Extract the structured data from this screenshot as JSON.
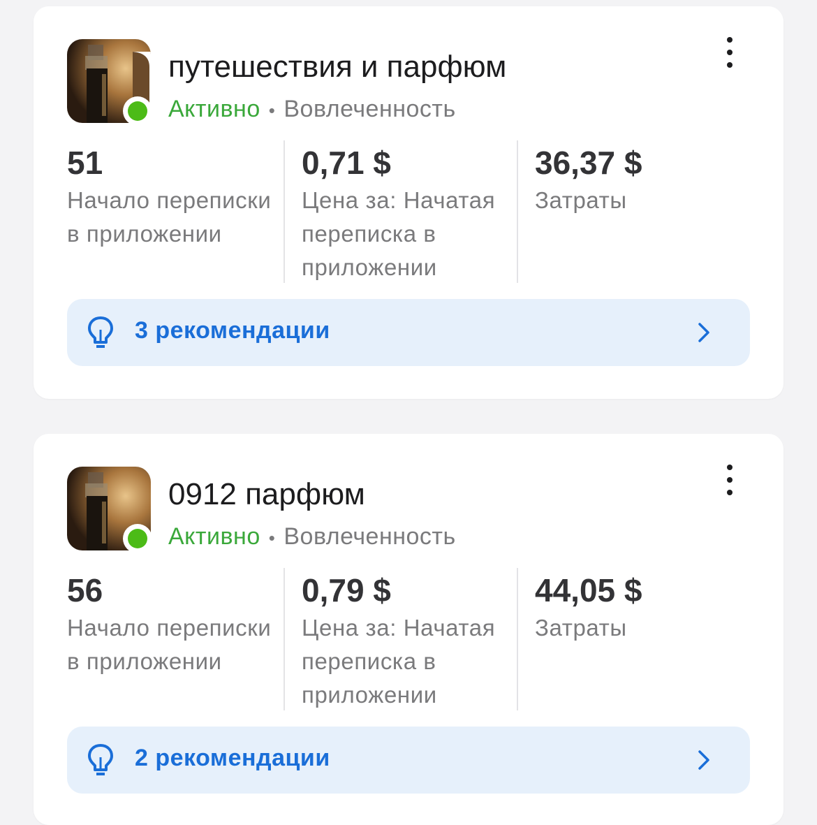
{
  "campaigns": [
    {
      "title": "путешествия и парфюм",
      "status": "Активно",
      "separator": "•",
      "objective": "Вовлеченность",
      "metrics": [
        {
          "value": "51",
          "label": "Начало переписки в приложении"
        },
        {
          "value": "0,71 $",
          "label": "Цена за: Начатая переписка в приложении"
        },
        {
          "value": "36,37 $",
          "label": "Затраты"
        }
      ],
      "recommendations": "3 рекомендации",
      "icons": {
        "menu": "more-vertical-icon",
        "bulb": "lightbulb-icon",
        "chevron": "chevron-right-icon"
      }
    },
    {
      "title": "0912 парфюм",
      "status": "Активно",
      "separator": "•",
      "objective": "Вовлеченность",
      "metrics": [
        {
          "value": "56",
          "label": "Начало переписки в приложении"
        },
        {
          "value": "0,79 $",
          "label": "Цена за: Начатая переписка в приложении"
        },
        {
          "value": "44,05 $",
          "label": "Затраты"
        }
      ],
      "recommendations": "2 рекомендации",
      "icons": {
        "menu": "more-vertical-icon",
        "bulb": "lightbulb-icon",
        "chevron": "chevron-right-icon"
      }
    }
  ],
  "colors": {
    "active": "#3aa83a",
    "status_dot": "#4cbb17",
    "accent": "#1a6ed8",
    "reco_bg": "#e6f0fb"
  }
}
